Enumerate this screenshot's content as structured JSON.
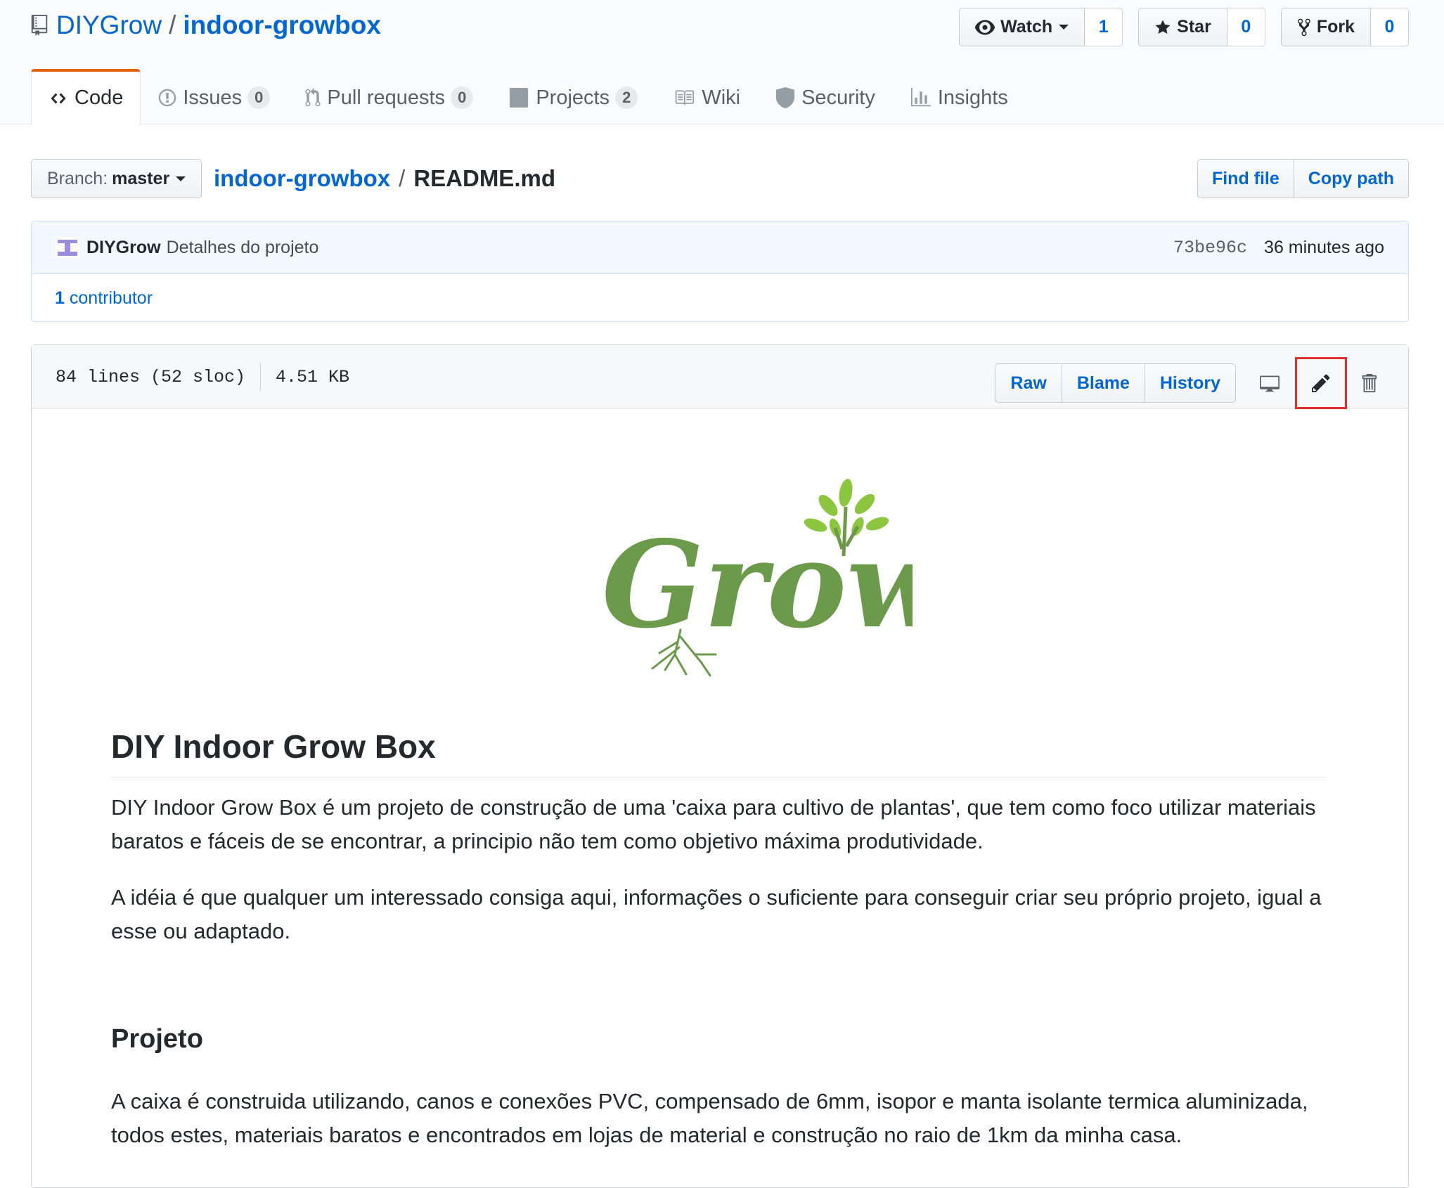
{
  "repo": {
    "owner": "DIYGrow",
    "separator": "/",
    "name": "indoor-growbox"
  },
  "actions": {
    "watch": {
      "label": "Watch",
      "count": "1"
    },
    "star": {
      "label": "Star",
      "count": "0"
    },
    "fork": {
      "label": "Fork",
      "count": "0"
    }
  },
  "tabs": [
    {
      "label": "Code"
    },
    {
      "label": "Issues",
      "counter": "0"
    },
    {
      "label": "Pull requests",
      "counter": "0"
    },
    {
      "label": "Projects",
      "counter": "2"
    },
    {
      "label": "Wiki"
    },
    {
      "label": "Security"
    },
    {
      "label": "Insights"
    }
  ],
  "file_nav": {
    "branch_label": "Branch:",
    "branch_value": "master",
    "breadcrumb_repo": "indoor-growbox",
    "breadcrumb_sep": "/",
    "breadcrumb_file": "README.md",
    "find_file": "Find file",
    "copy_path": "Copy path"
  },
  "commit": {
    "author": "DIYGrow",
    "message": "Detalhes do projeto",
    "sha": "73be96c",
    "time": "36 minutes ago",
    "contributors_count": "1",
    "contributors_label": "contributor"
  },
  "file": {
    "lines": "84 lines (52 sloc)",
    "size": "4.51 KB",
    "raw": "Raw",
    "blame": "Blame",
    "history": "History"
  },
  "readme": {
    "logo_text": "Grow",
    "h1": "DIY Indoor Grow Box",
    "p1": "DIY Indoor Grow Box é um projeto de construção de uma 'caixa para cultivo de plantas', que tem como foco utilizar materiais baratos e fáceis de se encontrar, a principio não tem como objetivo máxima produtividade.",
    "p2": "A idéia é que qualquer um interessado consiga aqui, informações o suficiente para conseguir criar seu próprio projeto, igual a esse ou adaptado.",
    "h2": "Projeto",
    "p3": "A caixa é construida utilizando, canos e conexões PVC, compensado de 6mm, isopor e manta isolante termica aluminizada, todos estes, materiais baratos e encontrados em lojas de material e construção no raio de 1km da minha casa."
  },
  "colors": {
    "link": "#0366d6",
    "selected_tab_accent": "#e36209",
    "highlight_box": "#e0302d",
    "logo_green": "#6a9a4a"
  },
  "icons": [
    "repo-icon",
    "eye-icon",
    "star-icon",
    "fork-icon",
    "code-icon",
    "issue-icon",
    "pull-request-icon",
    "project-icon",
    "book-icon",
    "shield-icon",
    "graph-icon",
    "desktop-icon",
    "pencil-icon",
    "trash-icon"
  ]
}
